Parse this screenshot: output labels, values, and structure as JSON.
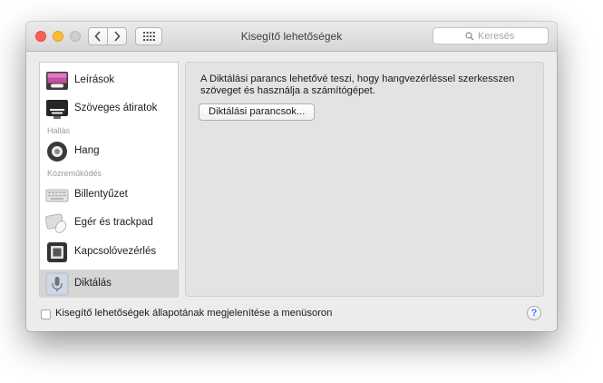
{
  "window": {
    "title": "Kisegítő lehetőségek",
    "search_placeholder": "Keresés"
  },
  "sidebar": {
    "items": [
      {
        "label": "Leírások",
        "icon": "descriptions-icon"
      },
      {
        "label": "Szöveges átiratok",
        "icon": "captions-icon"
      },
      {
        "label": "Hang",
        "icon": "speaker-icon"
      },
      {
        "label": "Billentyűzet",
        "icon": "keyboard-icon"
      },
      {
        "label": "Egér és trackpad",
        "icon": "mouse-trackpad-icon"
      },
      {
        "label": "Kapcsolóvezérlés",
        "icon": "switch-control-icon"
      },
      {
        "label": "Diktálás",
        "icon": "microphone-icon",
        "selected": true
      }
    ],
    "sections": [
      "Hallás",
      "Közreműködés"
    ]
  },
  "content": {
    "description_line1": "A Diktálási parancs lehetővé teszi, hogy hangvezérléssel szerkesszen",
    "description_line2": "szöveget és használja a számítógépet.",
    "button_label": "Diktálási parancsok..."
  },
  "footer": {
    "checkbox_label": "Kisegítő lehetőségek állapotának megjelenítése a menüsoron",
    "checkbox_checked": false,
    "help_label": "?"
  },
  "colors": {
    "close": "#fc5f57",
    "minimize": "#fdbd2e",
    "zoom_disabled": "#cfcfcf",
    "selected_row": "#d5d5d5",
    "accent": "#2f7cf6"
  }
}
